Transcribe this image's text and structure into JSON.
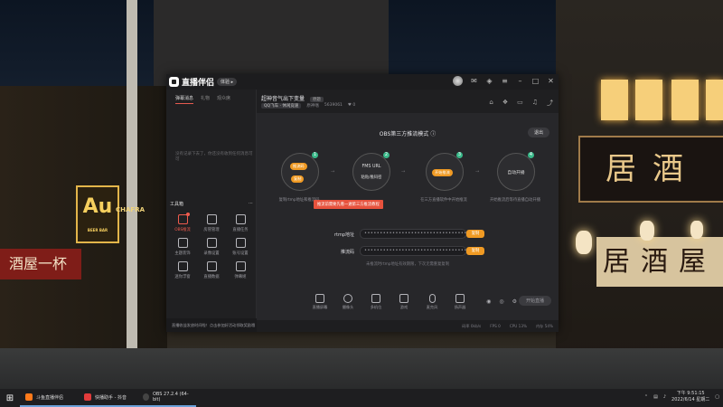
{
  "app": {
    "name": "直播伴侣",
    "version_badge": "体验 ▸",
    "room": {
      "title": "超神音气出下变量",
      "tag": "原题",
      "category": "QQ飞车 · 休闲竞速",
      "stream_name": "原神嗜",
      "stream_id": "5639061",
      "fans": "0"
    },
    "sidebar_tabs": [
      "弹幕消息",
      "礼物",
      "观众席"
    ],
    "sidebar_empty_text": "没有记录下去了，你还没有收到任何消息可可",
    "tools_title": "工具箱",
    "tools": [
      {
        "label": "OBS推流",
        "active": true,
        "badge": true
      },
      {
        "label": "房管管理",
        "active": false,
        "badge": false
      },
      {
        "label": "直播任务",
        "active": false,
        "badge": false
      },
      {
        "label": "主题装饰",
        "active": false,
        "badge": false
      },
      {
        "label": "录像设置",
        "active": false,
        "badge": false
      },
      {
        "label": "账号设置",
        "active": false,
        "badge": false
      },
      {
        "label": "迷你浮窗",
        "active": false,
        "badge": false
      },
      {
        "label": "直播数据",
        "active": false,
        "badge": false
      },
      {
        "label": "弹幕姬",
        "active": false,
        "badge": false
      }
    ],
    "obs_mode_title": "OBS第三方推流模式",
    "exit_label": "退出",
    "steps": [
      {
        "num": "1",
        "btn_top": "推流码",
        "btn_bottom": "复制",
        "label": "复制rtmp地址和推流码"
      },
      {
        "num": "2",
        "title": "FMS URL",
        "subtitle": "粘贴/推码密",
        "label": ""
      },
      {
        "num": "3",
        "pill": "开始推流",
        "label": "在三方直播软件中开始推流"
      },
      {
        "num": "4",
        "title": "自动开播",
        "label": "开始推流后等待直播自动开播"
      }
    ],
    "step2_button": "推流前需要先看一遍第三方推流教程",
    "fields": {
      "rtmp_label": "rtmp地址",
      "rtmp_value": "••••••••••••••••••••••••••••••••••",
      "key_label": "推流码",
      "key_value": "••••••••••••••••••••••••••••••••••",
      "copy_label": "复制"
    },
    "hint": "未推流时rtmp地址有效期限，下次无需重复复制",
    "bottom_tools": [
      "直播屏幕",
      "摄像头",
      "多机位",
      "游戏",
      "麦克风",
      "扬声器"
    ],
    "start_label": "开始直播",
    "status": [
      "码率 0kb/s",
      "FPS 0",
      "CPU 13%",
      "内存 54%"
    ],
    "notice": "直播收益发放时间啦！点击参加好活动领取奖励哦"
  },
  "taskbar": {
    "items": [
      {
        "label": "斗鱼直播伴侣",
        "color": "#ff7a1a"
      },
      {
        "label": "快播助手 - 抖音",
        "color": "#e23b3b"
      },
      {
        "label": "OBS 27.2.4 (64-bit)",
        "color": "#2b2b2b"
      }
    ],
    "time": "下午 9:51:15",
    "date": "2022/6/14 星期二"
  },
  "colors": {
    "accent_orange": "#f09a23",
    "accent_red": "#e7523d",
    "step_green": "#3ab98a"
  }
}
